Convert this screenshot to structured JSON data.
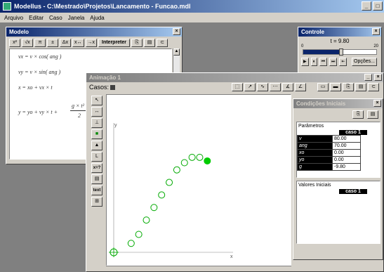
{
  "app": {
    "title": "Modellus - C:\\Mestrado\\Projetos\\Lancamento - Funcao.mdl"
  },
  "menu": [
    "Arquivo",
    "Editar",
    "Caso",
    "Janela",
    "Ajuda"
  ],
  "modelo": {
    "title": "Modelo",
    "toolbar": [
      "x²",
      "√x",
      "π",
      "±",
      "Δx",
      "x↔",
      "→x"
    ],
    "interpreter_label": "Interpreter",
    "equations": [
      "vx = v × cos( ang )",
      "vy = v × sin( ang )",
      "x = xo + vx × t",
      "y = yo + vy × t +"
    ],
    "fraction": {
      "num": "g × t²",
      "den": "2"
    }
  },
  "controle": {
    "title": "Controle",
    "time_label": "t = 9.80",
    "scale_left": "0",
    "scale_right": "20",
    "options_label": "Opções..."
  },
  "animacao": {
    "title": "Animação 1",
    "casos_label": "Casos:",
    "side_buttons": [
      "↖",
      "↔",
      "⊥",
      "■",
      "▲",
      "L",
      "x=?",
      "▤",
      "text",
      "⊞"
    ],
    "axis_label_y": "y",
    "axis_label_x": "x",
    "trajectory_x": [
      16,
      23,
      30,
      37,
      44,
      51,
      58,
      65,
      72,
      79,
      86
    ],
    "trajectory_y": [
      5,
      10,
      18,
      25,
      32,
      39,
      46,
      50,
      53,
      53,
      51
    ]
  },
  "condicoes": {
    "title": "Condições Iniciais",
    "parametros_label": "Parâmetros",
    "case_label": "caso 1",
    "params": [
      {
        "name": "v",
        "value": "80.00"
      },
      {
        "name": "ang",
        "value": "70.00"
      },
      {
        "name": "xo",
        "value": "0.00"
      },
      {
        "name": "yo",
        "value": "0.00"
      },
      {
        "name": "g",
        "value": "-9.80"
      }
    ],
    "valores_label": "Valores Iniciais",
    "valores_case": "caso 1"
  },
  "colors": {
    "titlebar": "#0a246a",
    "ball": "#00cc00",
    "trail": "#00aa00"
  }
}
